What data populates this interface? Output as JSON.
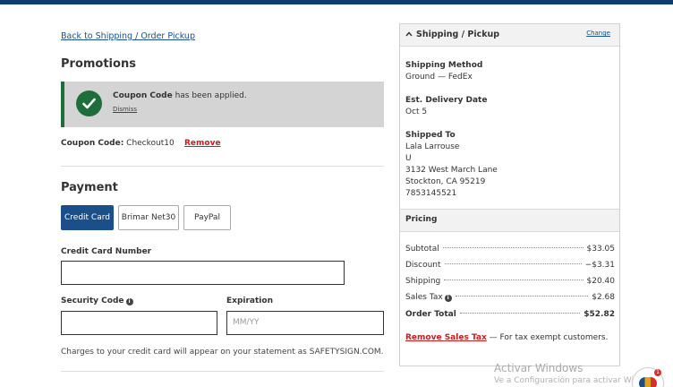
{
  "nav": {
    "back_label": "Back to Shipping / Order Pickup"
  },
  "promotions": {
    "heading": "Promotions",
    "coupon_bold": "Coupon Code",
    "coupon_msg": " has been applied.",
    "dismiss": "Dismiss",
    "code_label": "Coupon Code:",
    "code_value": " Checkout10",
    "remove": "Remove"
  },
  "payment": {
    "heading": "Payment",
    "methods": [
      "Credit Card",
      "Brimar Net30",
      "PayPal"
    ],
    "selected": "Credit Card",
    "card_number_label": "Credit Card Number",
    "card_number_value": "",
    "security_label": "Security Code",
    "security_value": "",
    "expiration_label": "Expiration",
    "expiration_placeholder": "MM/YY",
    "charges_note": "Charges to your credit card will appear on your statement as SAFETYSIGN.COM."
  },
  "summary": {
    "title": "Shipping / Pickup",
    "change": "Change",
    "method_label": "Shipping Method",
    "method_value": "Ground — FedEx",
    "delivery_label": "Est. Delivery Date",
    "delivery_value": "Oct 5",
    "shipped_label": "Shipped To",
    "address": [
      "Lala Larrouse",
      "U",
      "3132 West March Lane",
      "Stockton, CA 95219",
      "7853145521"
    ]
  },
  "pricing": {
    "heading": "Pricing",
    "rows": [
      {
        "label": "Subtotal",
        "value": "$33.05"
      },
      {
        "label": "Discount",
        "value": "−$3.31"
      },
      {
        "label": "Shipping",
        "value": "$20.40"
      },
      {
        "label": "Sales Tax",
        "value": "$2.68"
      },
      {
        "label": "Order Total",
        "value": "$52.82"
      }
    ],
    "remove_tax_link": "Remove Sales Tax",
    "remove_tax_note": " — For tax exempt customers."
  },
  "overlay": {
    "watermark_title": "Activar Windows",
    "watermark_sub": "Ve a Configuración para activar Windows.",
    "chat_count": "1"
  },
  "colors": {
    "primary": "#1a4f8a",
    "success": "#1e6e3c",
    "danger": "#c41e1e",
    "topbar": "#0e3d6e"
  }
}
